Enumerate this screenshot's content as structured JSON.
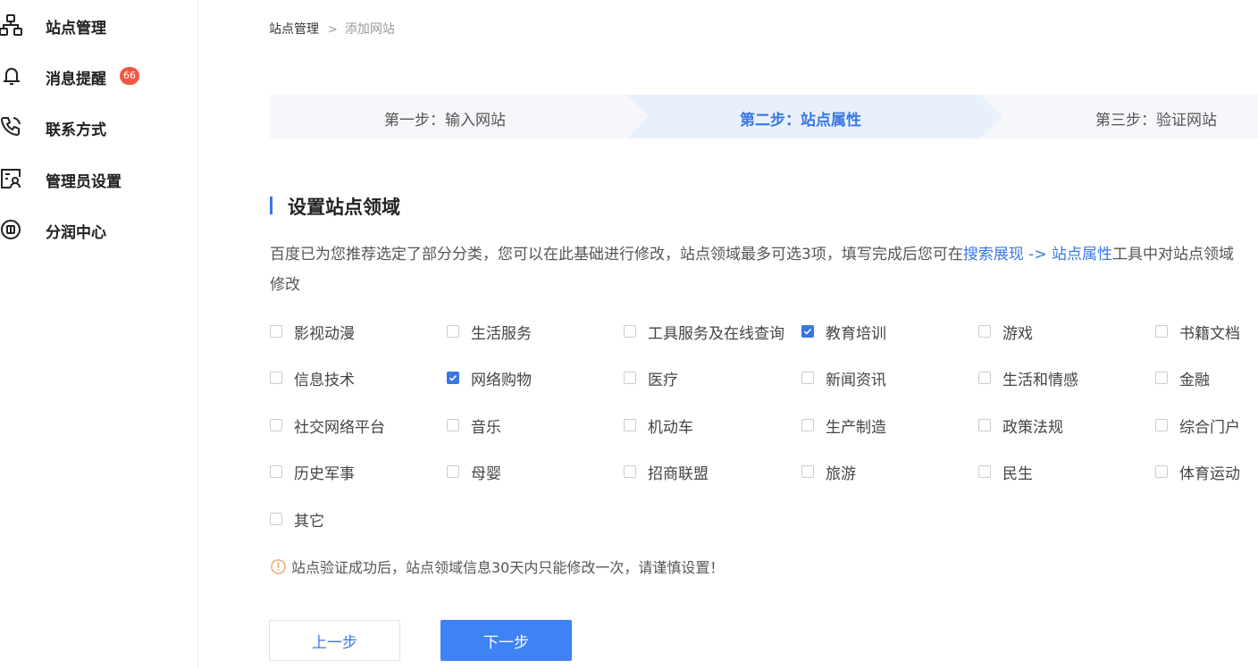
{
  "sidebar": {
    "items": [
      {
        "label": "站点管理",
        "icon": "sitemap-icon"
      },
      {
        "label": "消息提醒",
        "icon": "bell-icon",
        "badge": "66"
      },
      {
        "label": "联系方式",
        "icon": "phone-icon"
      },
      {
        "label": "管理员设置",
        "icon": "admin-icon"
      },
      {
        "label": "分润中心",
        "icon": "revenue-icon"
      }
    ]
  },
  "breadcrumb": {
    "home": "站点管理",
    "separator": ">",
    "current": "添加网站"
  },
  "steps": [
    {
      "label": "第一步：输入网站",
      "state": "done"
    },
    {
      "label": "第二步：站点属性",
      "state": "active"
    },
    {
      "label": "第三步：验证网站",
      "state": "pending"
    }
  ],
  "section": {
    "title": "设置站点领域",
    "desc_prefix": "百度已为您推荐选定了部分分类，您可以在此基础进行修改，站点领域最多可选3项，填写完成后您可在",
    "desc_link": "搜索展现 -> 站点属性",
    "desc_suffix": "工具中对站点领域",
    "desc_line2": "修改"
  },
  "categories": [
    {
      "label": "影视动漫",
      "checked": false
    },
    {
      "label": "生活服务",
      "checked": false
    },
    {
      "label": "工具服务及在线查询",
      "checked": false
    },
    {
      "label": "教育培训",
      "checked": true
    },
    {
      "label": "游戏",
      "checked": false
    },
    {
      "label": "书籍文档",
      "checked": false
    },
    {
      "label": "信息技术",
      "checked": false
    },
    {
      "label": "网络购物",
      "checked": true
    },
    {
      "label": "医疗",
      "checked": false
    },
    {
      "label": "新闻资讯",
      "checked": false
    },
    {
      "label": "生活和情感",
      "checked": false
    },
    {
      "label": "金融",
      "checked": false
    },
    {
      "label": "社交网络平台",
      "checked": false
    },
    {
      "label": "音乐",
      "checked": false
    },
    {
      "label": "机动车",
      "checked": false
    },
    {
      "label": "生产制造",
      "checked": false
    },
    {
      "label": "政策法规",
      "checked": false
    },
    {
      "label": "综合门户",
      "checked": false
    },
    {
      "label": "历史军事",
      "checked": false
    },
    {
      "label": "母婴",
      "checked": false
    },
    {
      "label": "招商联盟",
      "checked": false
    },
    {
      "label": "旅游",
      "checked": false
    },
    {
      "label": "民生",
      "checked": false
    },
    {
      "label": "体育运动",
      "checked": false
    },
    {
      "label": "其它",
      "checked": false
    }
  ],
  "notice": {
    "text": "站点验证成功后，站点领域信息30天内只能修改一次，请谨慎设置！",
    "icon": "warning-icon"
  },
  "buttons": {
    "prev": "上一步",
    "next": "下一步"
  },
  "colors": {
    "accent": "#3977e6",
    "primary_button": "#3f82f3",
    "badge": "#f25745",
    "warning": "#f0a26a"
  }
}
